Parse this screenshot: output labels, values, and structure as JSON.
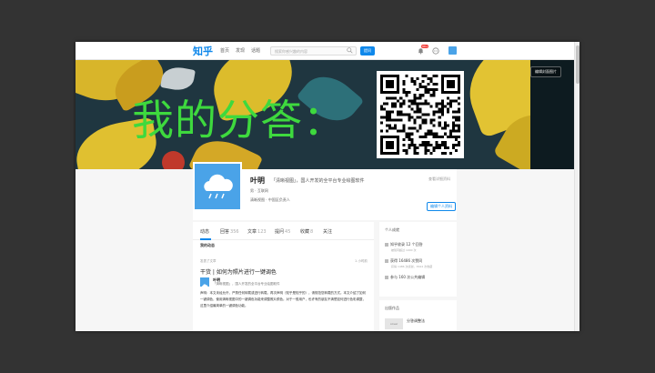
{
  "nav": {
    "logo": "知乎",
    "links": [
      "首页",
      "发现",
      "话题"
    ],
    "search_placeholder": "搜索你感兴趣的内容",
    "ask_label": "提问",
    "notif_badge": "99+"
  },
  "banner": {
    "overlay_text": "我的分答：",
    "edit_cover": "编辑封面图片"
  },
  "profile": {
    "name": "叶明",
    "headline": "「清晰视图」，国人开发的全平台专业绘图软件",
    "detail_1": "男 · 互联网",
    "detail_2": "清晰视图 · 中国区负责人",
    "view_detail": "查看详细资料",
    "edit_btn": "编辑个人资料"
  },
  "tabs": [
    {
      "label": "动态",
      "count": ""
    },
    {
      "label": "回答",
      "count": "356"
    },
    {
      "label": "文章",
      "count": "123"
    },
    {
      "label": "提问",
      "count": "45"
    },
    {
      "label": "收藏",
      "count": "8"
    },
    {
      "label": "关注",
      "count": ""
    }
  ],
  "activity": {
    "section_title": "我的动态",
    "meta": "发表了文章",
    "time": "1 小时前",
    "title": "干货 | 如何为照片进行一键调色",
    "author": "叶明",
    "author_bio": "「清晰视图」，国人开发的全平台专业绘图软件",
    "body": "声明：本文未经允许，严禁任何转载或进行转载。再次声明（知乎是知乎的），请规范您转载的方式。本文介绍了如何一键调色，使用清晰视图中的一键调色功能来调整照片颜色。对于一般用户，也许有的朋友不清楚如何进行色彩调整，这里介绍最简单的一键调色功能。"
  },
  "sidebar": {
    "title": "个人成就",
    "items": [
      {
        "label": "知乎收录 12 个回答",
        "sub": "被赞同超过 1000 次"
      },
      {
        "label": "获得 16486 次赞同",
        "sub": "获得 1486 次感谢，3624 次收藏"
      },
      {
        "label": "参与 160 次公共编辑",
        "sub": ""
      }
    ],
    "section2_title": "出版作品",
    "section2_item": "分答调整法",
    "section2_thumb": "cover"
  },
  "colors": {
    "accent": "#0f88eb",
    "banner_text": "#3ed93e",
    "avatar": "#4aa3e8"
  }
}
